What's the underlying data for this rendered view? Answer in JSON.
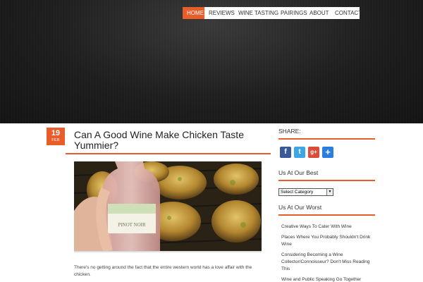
{
  "nav": {
    "items": [
      {
        "label": "HOME"
      },
      {
        "label": "REVIEWS"
      },
      {
        "label": "WINE TASTING"
      },
      {
        "label": "PAIRINGS"
      },
      {
        "label": "ABOUT"
      },
      {
        "label": "CONTACT"
      }
    ]
  },
  "post": {
    "date_day": "19",
    "date_month": "FEB",
    "title": "Can A Good Wine Make Chicken Taste Yummier?",
    "image_label": "PINOT NOIR",
    "excerpt": "There's no getting around the fact that the entire western world has a love affair with the chicken."
  },
  "sidebar": {
    "share_heading": "SHARE:",
    "share_icons": [
      "facebook-icon",
      "twitter-icon",
      "google-plus-icon",
      "addthis-icon"
    ],
    "best_heading": "Us At Our Best",
    "category_select": "Select Category",
    "worst_heading": "Us At Our Worst",
    "worst_items": [
      {
        "label": "Creative Ways To Cater With Wine"
      },
      {
        "label": "Places Where You Probably Shouldn't Drink Wine"
      },
      {
        "label": "Considering Becoming a Wine Collector/Connoisseur? Don't Miss Reading This"
      },
      {
        "label": "Wine and Public Speaking Go Together"
      }
    ]
  },
  "colors": {
    "accent": "#e85d2a",
    "header_bg": "#1e1e1e"
  }
}
